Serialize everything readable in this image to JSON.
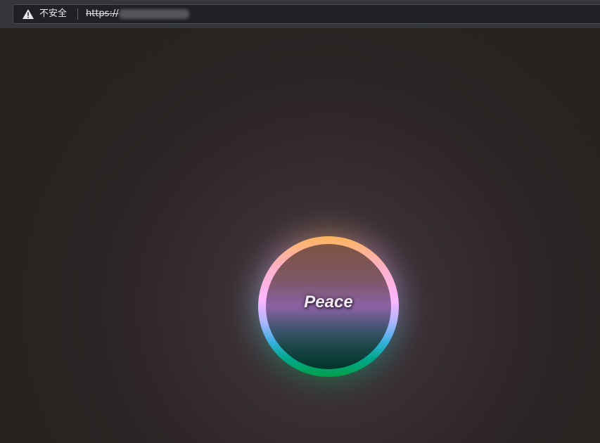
{
  "browser": {
    "security_warning": "不安全",
    "url": "https://",
    "warning_icon": "warning-triangle-icon"
  },
  "main": {
    "button_label": "Peace",
    "ring_colors": [
      "#ffb55c",
      "#ffb6ff",
      "#a9b4ff",
      "#00a88a",
      "#00a048"
    ]
  }
}
